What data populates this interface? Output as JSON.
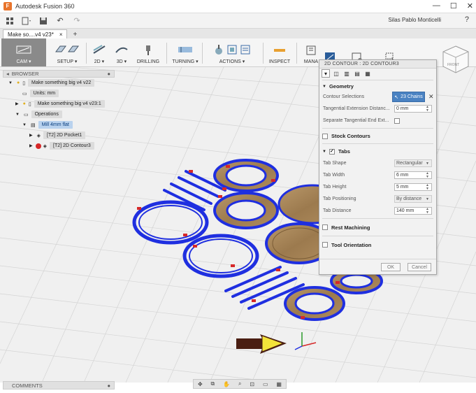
{
  "window": {
    "title": "Autodesk Fusion 360",
    "minimize": "—",
    "maximize": "☐",
    "close": "✕"
  },
  "quickaccess": {
    "user": "Silas Pablo Monticelli",
    "help": "?"
  },
  "tab": {
    "label": "Make so....v4 v23*",
    "close": "×",
    "add": "+"
  },
  "toolbar": {
    "items": [
      {
        "label": "CAM ▾"
      },
      {
        "label": "SETUP ▾"
      },
      {
        "label": "2D ▾"
      },
      {
        "label": "3D ▾"
      },
      {
        "label": "DRILLING"
      },
      {
        "label": "TURNING ▾"
      },
      {
        "label": "ACTIONS ▾"
      },
      {
        "label": "INSPECT"
      },
      {
        "label": "MANA"
      }
    ]
  },
  "browser": {
    "title": "BROWSER",
    "close": "●",
    "rows": [
      {
        "label": "Make something big v4 v22"
      },
      {
        "label": "Units: mm"
      },
      {
        "label": "Make something big v4 v23:1"
      },
      {
        "label": "Operations"
      },
      {
        "label": "Mill 4mm flat"
      },
      {
        "label": "[T2] 2D Pocket1"
      },
      {
        "label": "[T2] 2D Contour3"
      }
    ]
  },
  "comments": {
    "title": "COMMENTS",
    "close": "●"
  },
  "dialog": {
    "title": "2D CONTOUR : 2D CONTOUR3",
    "geometry": {
      "header": "Geometry",
      "contour_label": "Contour Selections",
      "chains_btn": "23 Chains",
      "chains_clear": "✕",
      "tangential_label": "Tangential Extension Distanc...",
      "tangential_value": "0 mm",
      "separate_label": "Separate Tangential End Ext..."
    },
    "stock": {
      "header": "Stock Contours"
    },
    "tabs": {
      "header": "Tabs",
      "shape_label": "Tab Shape",
      "shape_value": "Rectangular",
      "width_label": "Tab Width",
      "width_value": "6 mm",
      "height_label": "Tab Height",
      "height_value": "5 mm",
      "pos_label": "Tab Positioning",
      "pos_value": "By distance",
      "dist_label": "Tab Distance",
      "dist_value": "140 mm"
    },
    "rest": {
      "header": "Rest Machining"
    },
    "tool_orient": {
      "header": "Tool Orientation"
    },
    "ok": "OK",
    "cancel": "Cancel"
  },
  "viewcube": {
    "face": "FRONT"
  },
  "colors": {
    "toolpath": "#1f2fe0",
    "tab": "#d62828",
    "wood": "#9c7a4e",
    "accent": "#4a82c2"
  }
}
